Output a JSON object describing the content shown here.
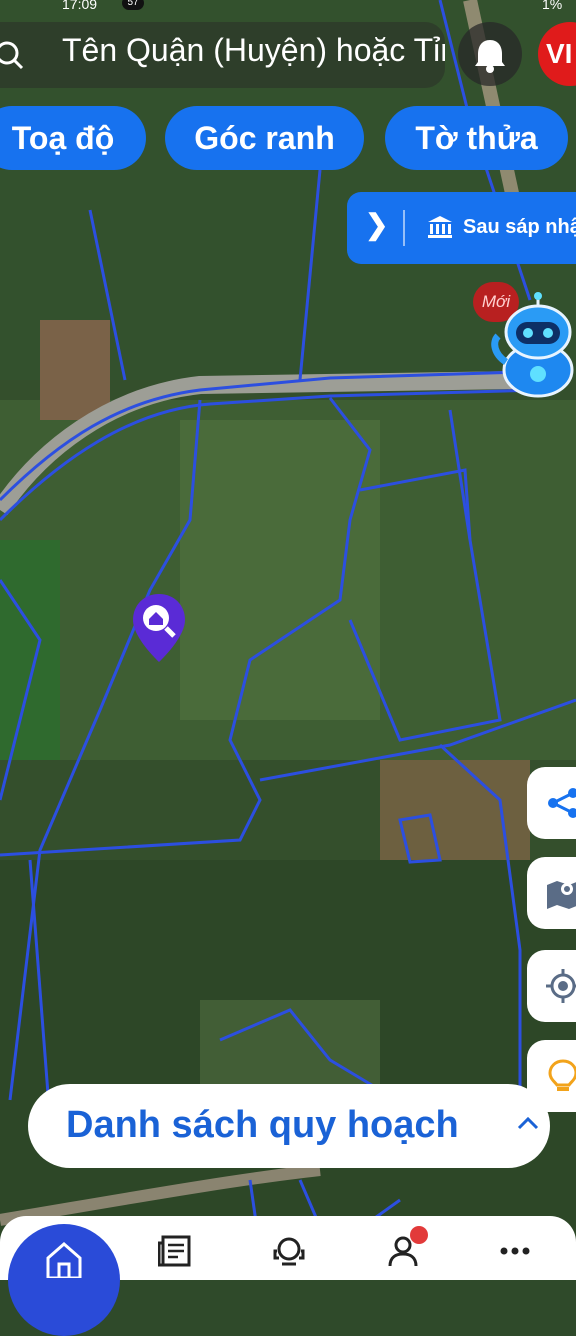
{
  "status_bar": {
    "time": "17:09",
    "badge": "57",
    "battery": "1%"
  },
  "search": {
    "placeholder": "Tên Quận (Huyện) hoặc Tỉnh"
  },
  "header": {
    "lang_label": "VI"
  },
  "tabs": [
    {
      "label": "Toạ độ"
    },
    {
      "label": "Góc ranh"
    },
    {
      "label": "Tờ thửa"
    }
  ],
  "merge_panel": {
    "label": "Sau sáp nhập"
  },
  "assistant": {
    "badge": "Mới"
  },
  "planning": {
    "label": "Danh sách quy hoạch"
  },
  "side_actions": [
    "share-icon",
    "map-icon",
    "locate-icon",
    "bulb-icon"
  ],
  "bottom_nav": [
    "home-icon",
    "news-icon",
    "support-icon",
    "account-icon",
    "more-icon"
  ],
  "colors": {
    "primary": "#1772ef",
    "nav_home": "#2a4bd8",
    "plot_lines": "#2c4fe0",
    "danger": "#e01b1b",
    "pin": "#5a2bd6"
  }
}
